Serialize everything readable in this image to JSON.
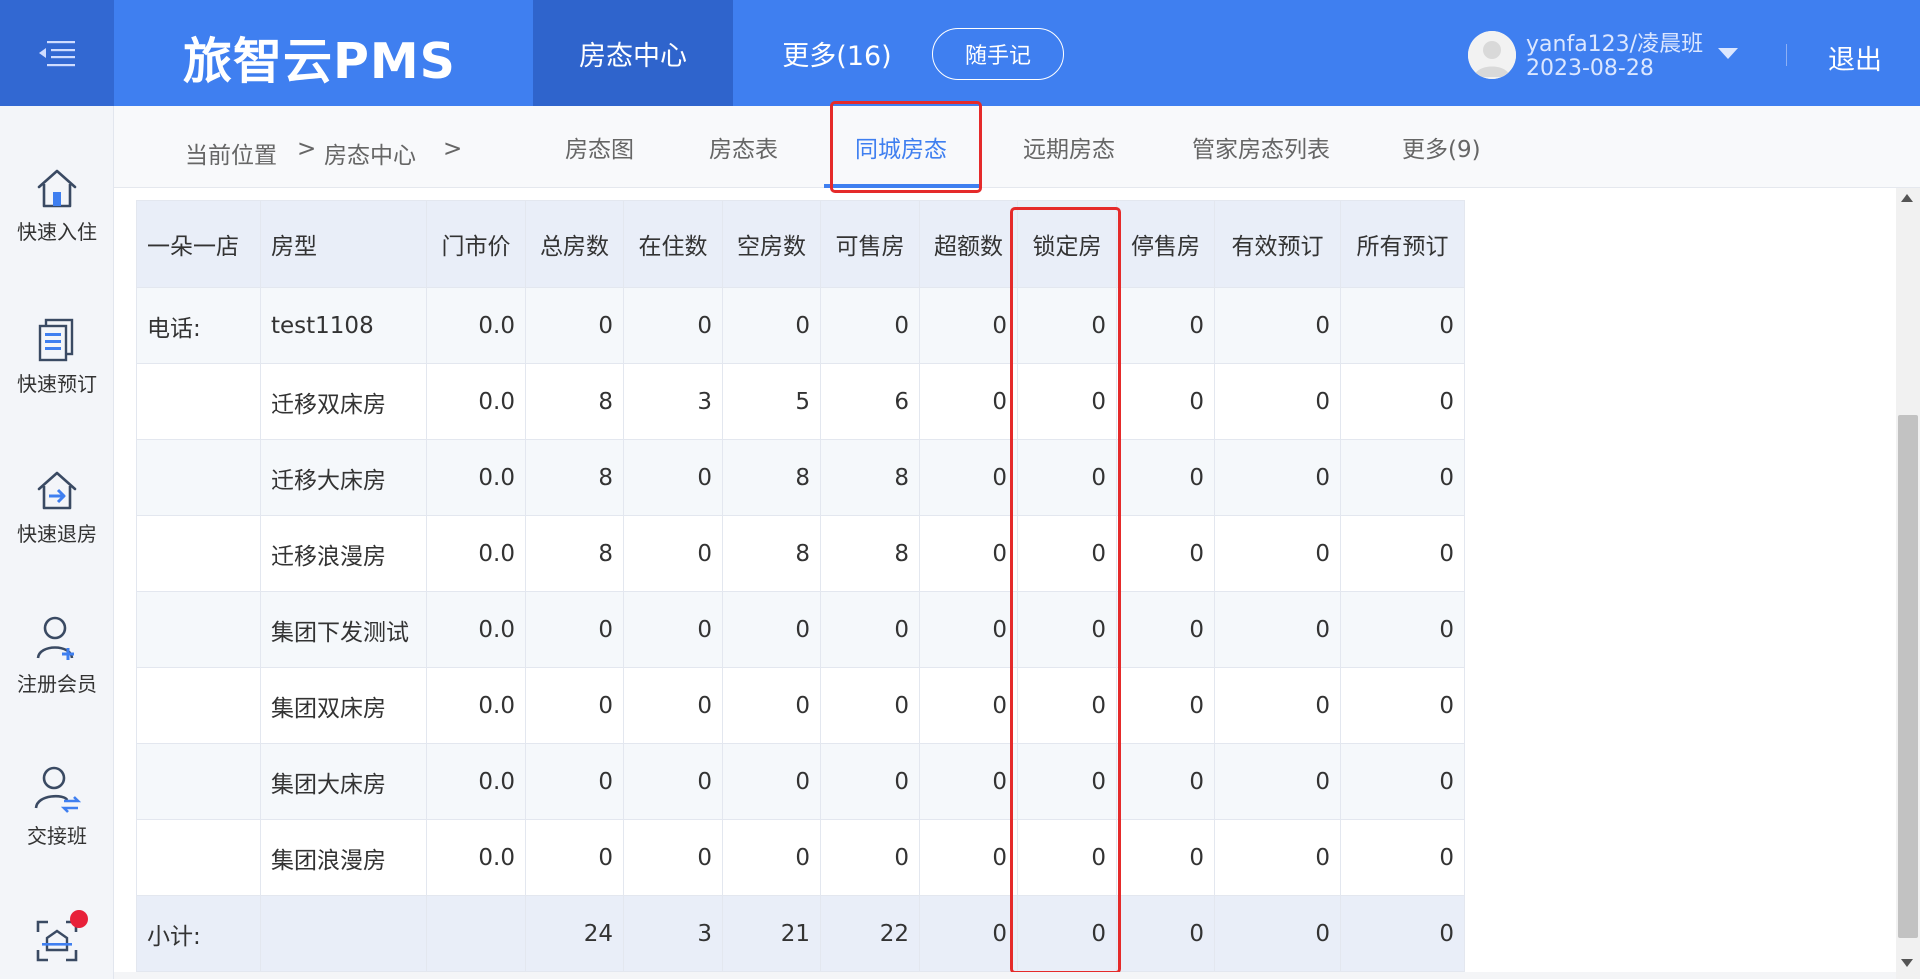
{
  "header": {
    "logo": "旅智云PMS",
    "nav_active": "房态中心",
    "nav_more": "更多(16)",
    "memo_button": "随手记",
    "user_name": "yanfa123/凌晨班",
    "user_date": "2023-08-28",
    "logout": "退出"
  },
  "sidebar": {
    "items": [
      {
        "label": "快速入住",
        "icon": "home-icon"
      },
      {
        "label": "快速预订",
        "icon": "document-icon"
      },
      {
        "label": "快速退房",
        "icon": "checkout-icon"
      },
      {
        "label": "注册会员",
        "icon": "add-member-icon"
      },
      {
        "label": "交接班",
        "icon": "shift-handover-icon"
      },
      {
        "label": "",
        "icon": "scan-icon"
      }
    ]
  },
  "breadcrumb": {
    "prefix": "当前位置",
    "sep1": ">",
    "current": "房态中心",
    "sep2": ">"
  },
  "subtabs": [
    "房态图",
    "房态表",
    "同城房态",
    "远期房态",
    "管家房态列表",
    "更多(9)"
  ],
  "active_subtab": "同城房态",
  "table": {
    "headers": [
      "一朵一店",
      "房型",
      "门市价",
      "总房数",
      "在住数",
      "空房数",
      "可售房",
      "超额数",
      "锁定房",
      "停售房",
      "有效预订",
      "所有预订"
    ],
    "rows": [
      [
        "电话:",
        "test1108",
        "0.0",
        "0",
        "0",
        "0",
        "0",
        "0",
        "0",
        "0",
        "0",
        "0"
      ],
      [
        "",
        "迁移双床房",
        "0.0",
        "8",
        "3",
        "5",
        "6",
        "0",
        "0",
        "0",
        "0",
        "0"
      ],
      [
        "",
        "迁移大床房",
        "0.0",
        "8",
        "0",
        "8",
        "8",
        "0",
        "0",
        "0",
        "0",
        "0"
      ],
      [
        "",
        "迁移浪漫房",
        "0.0",
        "8",
        "0",
        "8",
        "8",
        "0",
        "0",
        "0",
        "0",
        "0"
      ],
      [
        "",
        "集团下发测试",
        "0.0",
        "0",
        "0",
        "0",
        "0",
        "0",
        "0",
        "0",
        "0",
        "0"
      ],
      [
        "",
        "集团双床房",
        "0.0",
        "0",
        "0",
        "0",
        "0",
        "0",
        "0",
        "0",
        "0",
        "0"
      ],
      [
        "",
        "集团大床房",
        "0.0",
        "0",
        "0",
        "0",
        "0",
        "0",
        "0",
        "0",
        "0",
        "0"
      ],
      [
        "",
        "集团浪漫房",
        "0.0",
        "0",
        "0",
        "0",
        "0",
        "0",
        "0",
        "0",
        "0",
        "0"
      ]
    ],
    "total": [
      "小计:",
      "",
      "",
      "24",
      "3",
      "21",
      "22",
      "0",
      "0",
      "0",
      "0",
      "0"
    ]
  },
  "colors": {
    "header_bg": "#3f7ff0",
    "header_dark": "#2f64cc",
    "accent": "#3f7ff0",
    "highlight_red": "#e52a2a",
    "badge_red": "#e8213a"
  }
}
